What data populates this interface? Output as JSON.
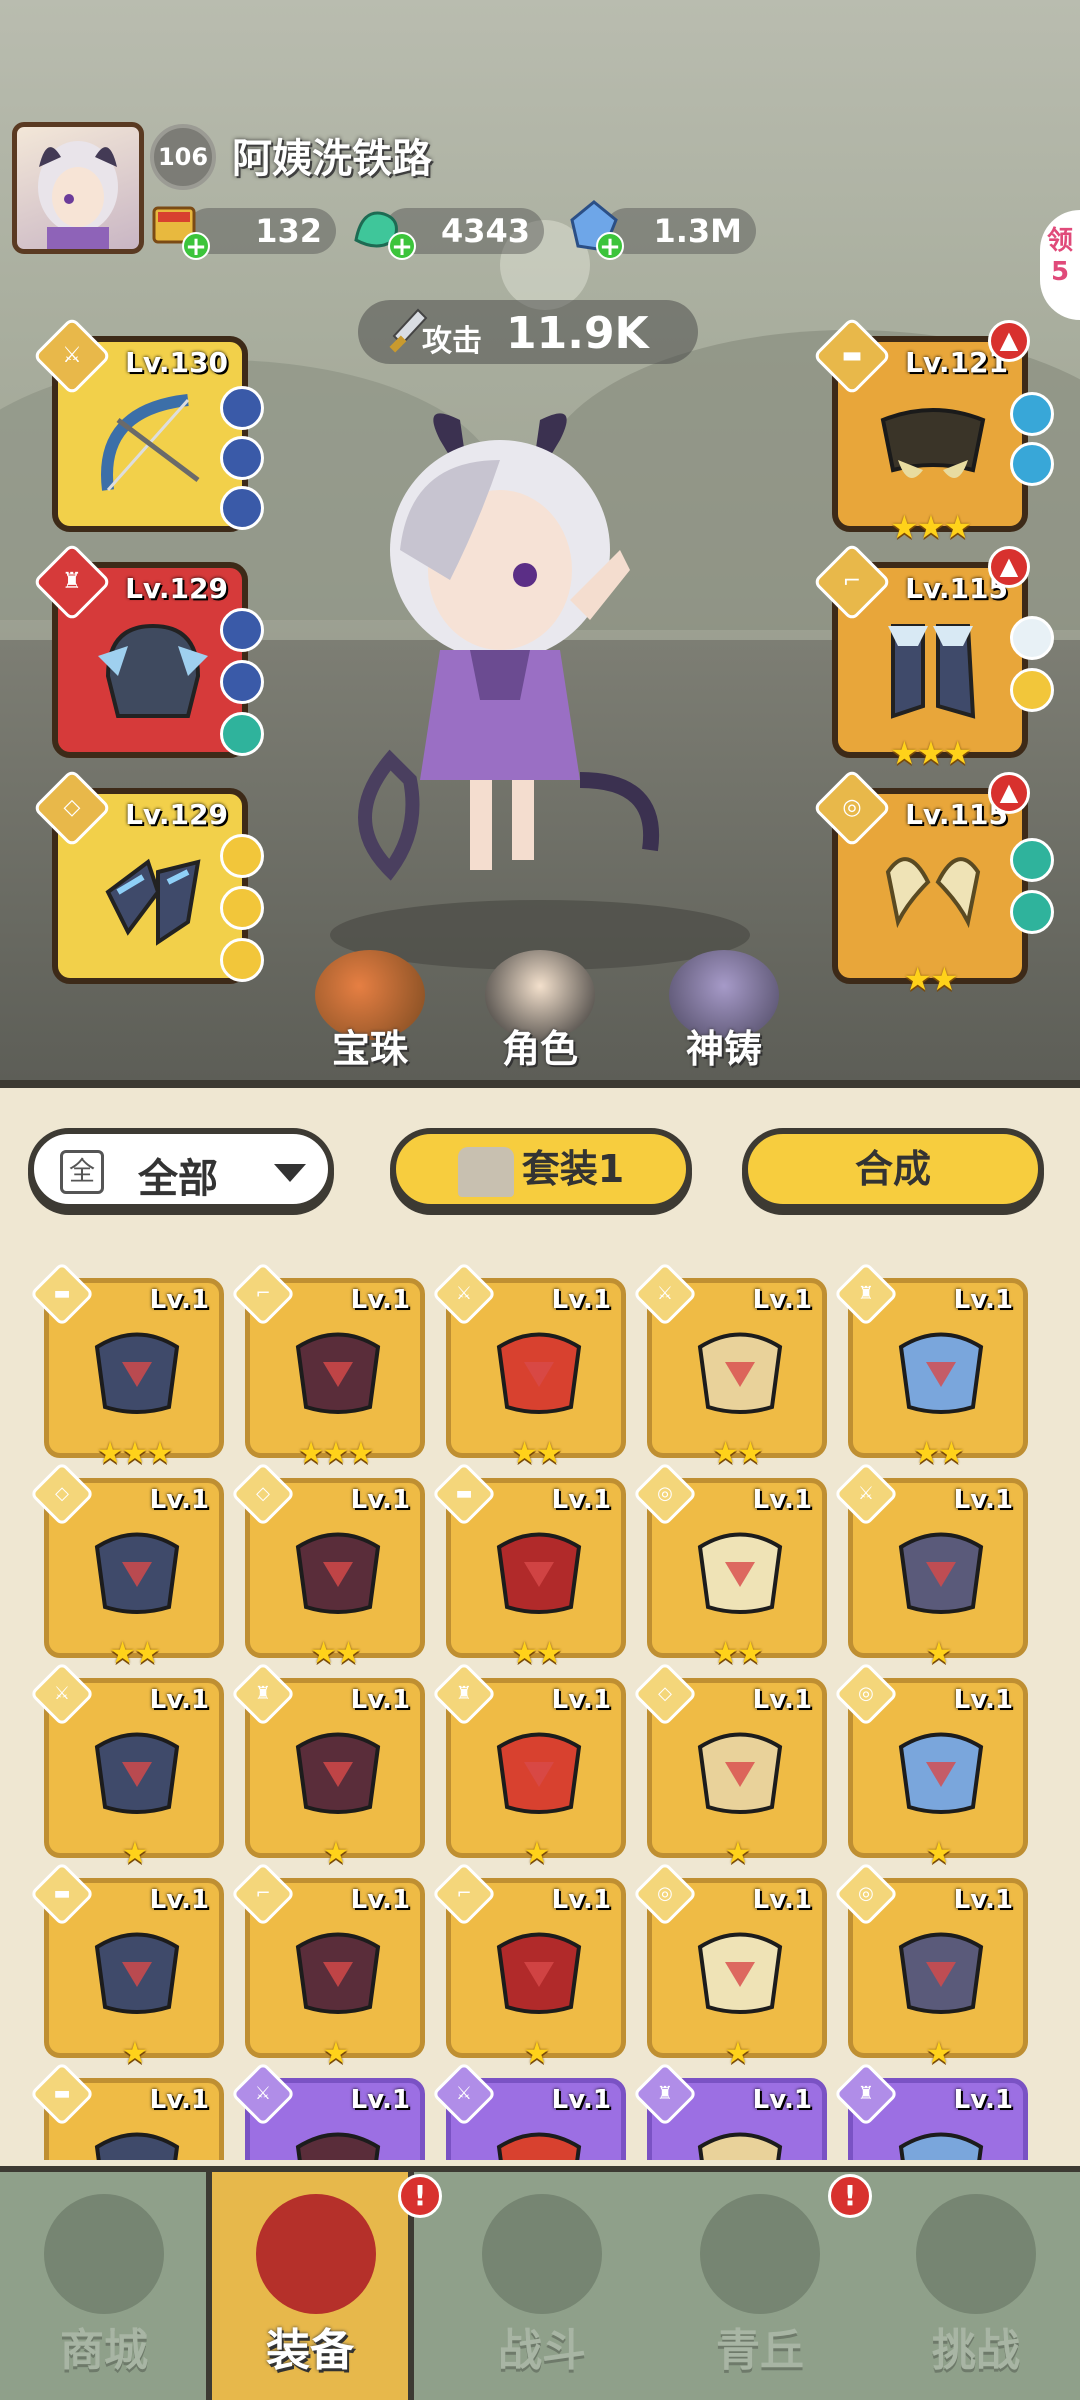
{
  "player": {
    "level": "106",
    "name": "阿姨洗铁路"
  },
  "resources": [
    {
      "icon": "scroll-icon",
      "value": "132"
    },
    {
      "icon": "jade-dragon-icon",
      "value": "4343"
    },
    {
      "icon": "crystal-icon",
      "value": "1.3M"
    }
  ],
  "attack": {
    "label": "攻击",
    "value": "11.9K"
  },
  "side_tag": "领 5",
  "equipped_left": [
    {
      "level": "Lv.130",
      "stars": "",
      "rarity": "yellow"
    },
    {
      "level": "Lv.129",
      "stars": "",
      "rarity": "red"
    },
    {
      "level": "Lv.129",
      "stars": "",
      "rarity": "yellow"
    }
  ],
  "equipped_right": [
    {
      "level": "Lv.121",
      "stars": "★★★"
    },
    {
      "level": "Lv.115",
      "stars": "★★★"
    },
    {
      "level": "Lv.115",
      "stars": "★★"
    }
  ],
  "quick_actions": [
    {
      "label": "宝珠"
    },
    {
      "label": "角色"
    },
    {
      "label": "神铸"
    }
  ],
  "filter": {
    "box": "全",
    "label": "全部"
  },
  "set_button": "套装1",
  "compose_button": "合成",
  "inventory": [
    {
      "level": "Lv.1",
      "stars": "★★★"
    },
    {
      "level": "Lv.1",
      "stars": "★★★"
    },
    {
      "level": "Lv.1",
      "stars": "★★"
    },
    {
      "level": "Lv.1",
      "stars": "★★"
    },
    {
      "level": "Lv.1",
      "stars": "★★"
    },
    {
      "level": "Lv.1",
      "stars": "★★"
    },
    {
      "level": "Lv.1",
      "stars": "★★"
    },
    {
      "level": "Lv.1",
      "stars": "★★"
    },
    {
      "level": "Lv.1",
      "stars": "★★"
    },
    {
      "level": "Lv.1",
      "stars": "★"
    },
    {
      "level": "Lv.1",
      "stars": "★"
    },
    {
      "level": "Lv.1",
      "stars": "★"
    },
    {
      "level": "Lv.1",
      "stars": "★"
    },
    {
      "level": "Lv.1",
      "stars": "★"
    },
    {
      "level": "Lv.1",
      "stars": "★"
    },
    {
      "level": "Lv.1",
      "stars": "★"
    },
    {
      "level": "Lv.1",
      "stars": "★"
    },
    {
      "level": "Lv.1",
      "stars": "★"
    },
    {
      "level": "Lv.1",
      "stars": "★"
    },
    {
      "level": "Lv.1",
      "stars": "★"
    },
    {
      "level": "Lv.1",
      "stars": ""
    },
    {
      "level": "Lv.1",
      "stars": ""
    },
    {
      "level": "Lv.1",
      "stars": ""
    },
    {
      "level": "Lv.1",
      "stars": ""
    },
    {
      "level": "Lv.1",
      "stars": ""
    }
  ],
  "tabs": [
    {
      "label": "商城",
      "badge": ""
    },
    {
      "label": "装备",
      "badge": "!"
    },
    {
      "label": "战斗",
      "badge": ""
    },
    {
      "label": "青丘",
      "badge": "!"
    },
    {
      "label": "挑战",
      "badge": ""
    }
  ],
  "colors": {
    "gold": "#efbb45",
    "purple": "#9c6fe3",
    "red": "#d63a3a",
    "accent_yellow": "#f7cd3e"
  }
}
